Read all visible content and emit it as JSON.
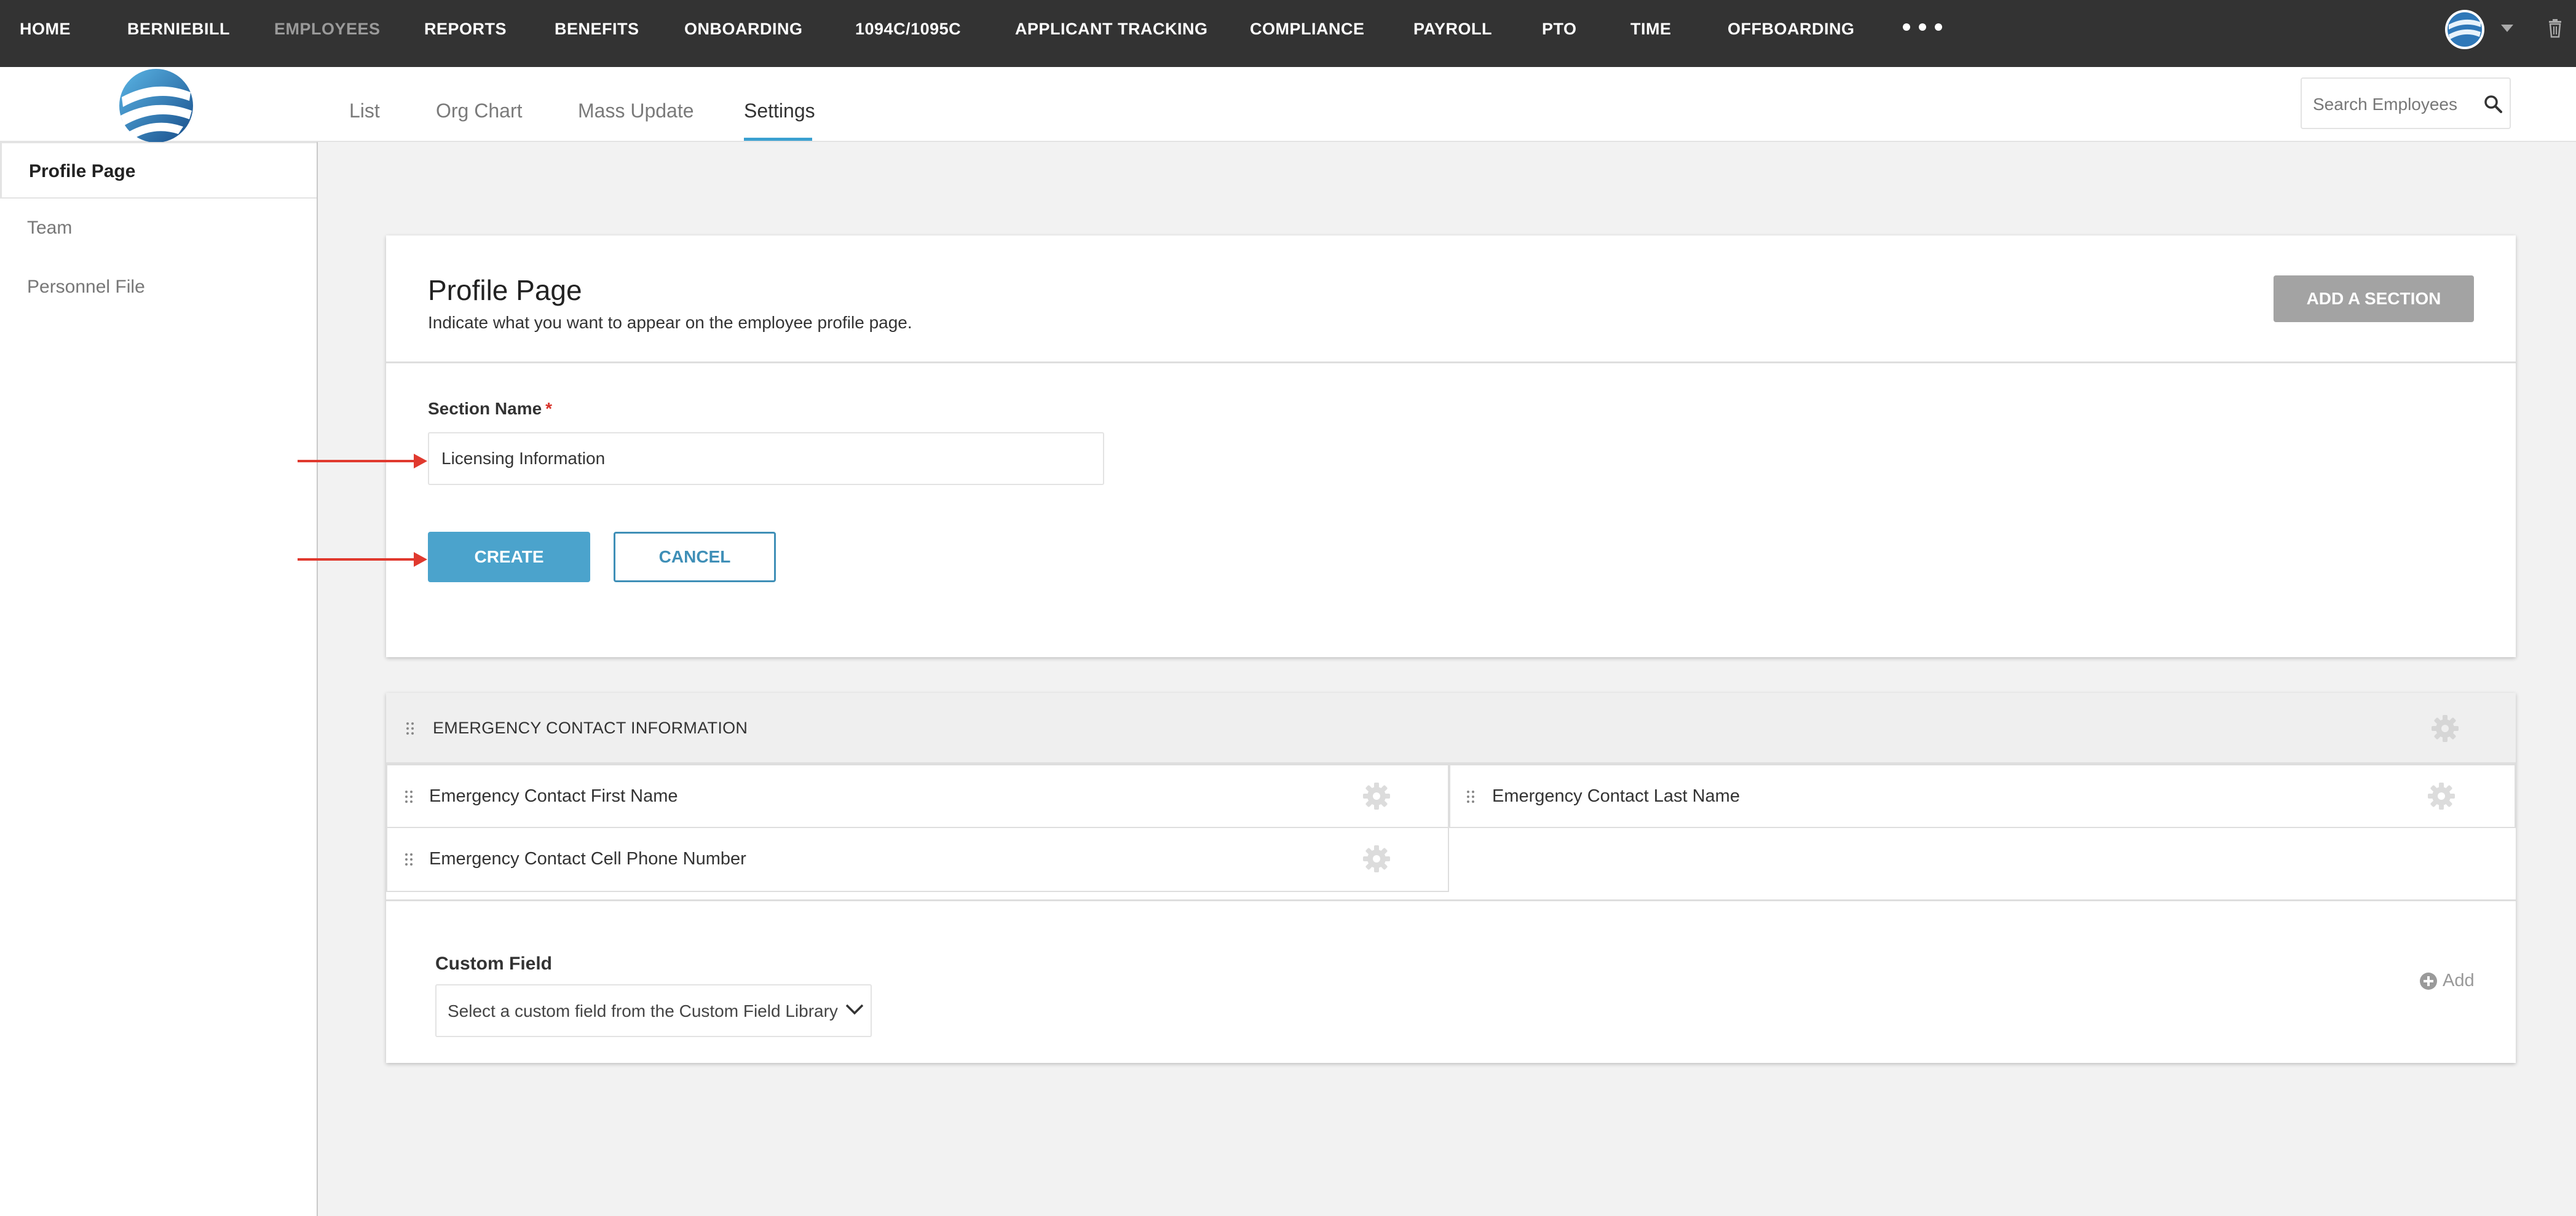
{
  "topnav": {
    "items": [
      "HOME",
      "BERNIEBILL",
      "EMPLOYEES",
      "REPORTS",
      "BENEFITS",
      "ONBOARDING",
      "1094C/1095C",
      "APPLICANT TRACKING",
      "COMPLIANCE",
      "PAYROLL",
      "PTO",
      "TIME",
      "OFFBOARDING"
    ],
    "active_item": "EMPLOYEES",
    "more_icon": "ellipsis-icon",
    "avatar_icon": "globe-avatar-icon",
    "trash_icon": "trash-icon"
  },
  "subnav": {
    "tabs": [
      "List",
      "Org Chart",
      "Mass Update",
      "Settings"
    ],
    "active_tab": "Settings",
    "search_placeholder": "Search Employees"
  },
  "sidebar": {
    "items": [
      "Profile Page",
      "Team",
      "Personnel File"
    ],
    "active_item": "Profile Page"
  },
  "profile_card": {
    "title": "Profile Page",
    "description": "Indicate what you want to appear on the employee profile page.",
    "add_section_label": "ADD A SECTION",
    "section_name_label": "Section Name",
    "required_mark": "*",
    "section_name_value": "Licensing Information",
    "create_label": "CREATE",
    "cancel_label": "CANCEL"
  },
  "section": {
    "title": "EMERGENCY CONTACT INFORMATION",
    "fields": [
      "Emergency Contact First Name",
      "Emergency Contact Last Name",
      "Emergency Contact Cell Phone Number"
    ],
    "custom_field_label": "Custom Field",
    "custom_field_select": "Select a custom field from the Custom Field Library",
    "add_label": "Add"
  },
  "colors": {
    "topbar": "#333333",
    "primary": "#4ba3cc",
    "annotation_arrow": "#e0392e",
    "tab_underline": "#3aa0d0"
  }
}
